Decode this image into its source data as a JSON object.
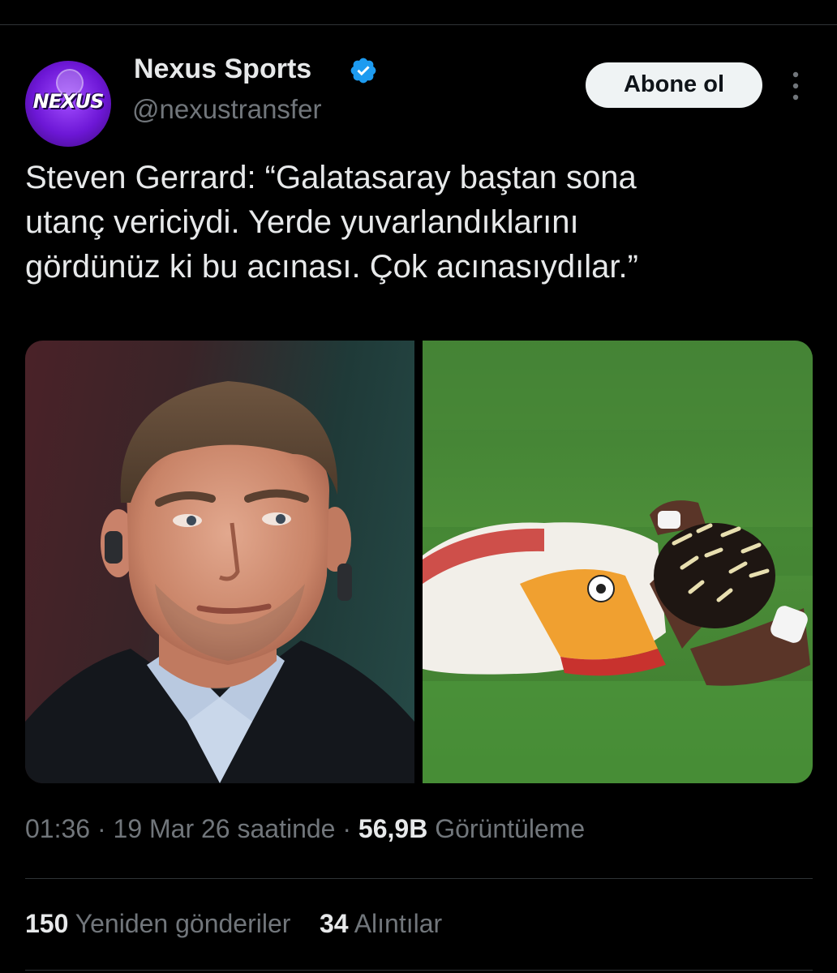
{
  "tweet": {
    "author": {
      "display_name": "Nexus Sports",
      "handle": "@nexustransfer",
      "verified": true,
      "avatar_text": "NEXUS",
      "avatar_icon": "nexus-logo-icon"
    },
    "follow_label": "Abone ol",
    "more_icon": "more-vertical-icon",
    "text_lines": [
      "Steven Gerrard: “Galatasaray baştan sona",
      "utanç vericiydi. Yerde yuvarlandıklarını",
      "gördünüz ki bu acınası. Çok acınasıydılar.”"
    ],
    "media": [
      {
        "kind": "photo",
        "subject": "steven-gerrard-portrait"
      },
      {
        "kind": "photo",
        "subject": "player-lying-on-pitch"
      }
    ],
    "meta": {
      "time": "01:36",
      "date": "19 Mar 26 saatinde",
      "views_count": "56,9B",
      "views_label": "Görüntüleme",
      "separator": "·"
    },
    "stats": {
      "retweets_count": "150",
      "retweets_label": "Yeniden gönderiler",
      "quotes_count": "34",
      "quotes_label": "Alıntılar"
    },
    "colors": {
      "background": "#000000",
      "text": "#e7e9ea",
      "secondary": "#71767b",
      "verified": "#1d9bf0",
      "divider": "#2f3336",
      "button_bg": "#eff3f4"
    }
  }
}
